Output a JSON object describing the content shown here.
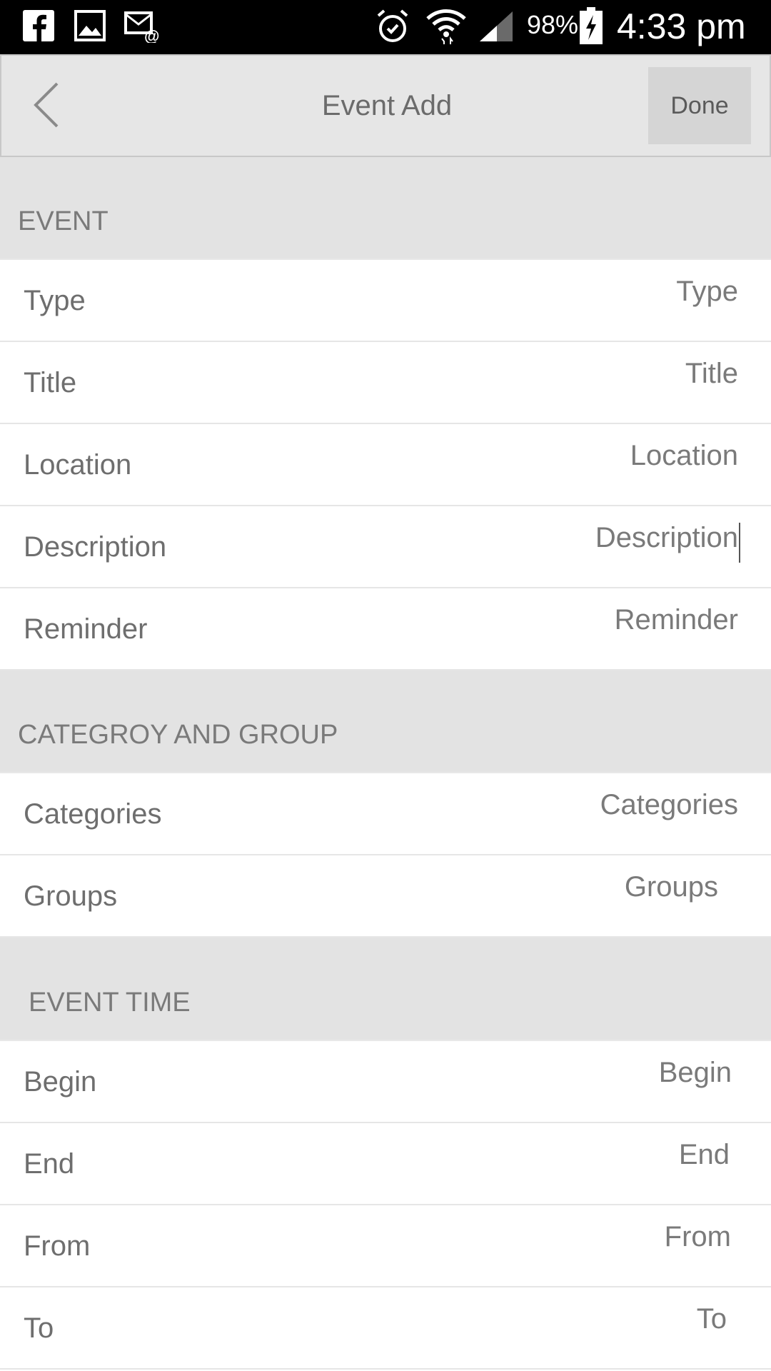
{
  "status_bar": {
    "battery": "98%",
    "time": "4:33 pm",
    "icons": [
      "facebook-icon",
      "image-icon",
      "email-icon",
      "alarm-icon",
      "wifi-icon",
      "signal-icon",
      "battery-charging-icon"
    ]
  },
  "nav": {
    "title": "Event Add",
    "done_label": "Done"
  },
  "sections": {
    "event": {
      "header": "EVENT",
      "rows": [
        {
          "label": "Type",
          "placeholder": "Type"
        },
        {
          "label": "Title",
          "placeholder": "Title"
        },
        {
          "label": "Location",
          "placeholder": "Location"
        },
        {
          "label": "Description",
          "placeholder": "Description"
        },
        {
          "label": "Reminder",
          "placeholder": "Reminder"
        }
      ]
    },
    "category_group": {
      "header": "CATEGROY AND GROUP",
      "rows": [
        {
          "label": "Categories",
          "placeholder": "Categories"
        },
        {
          "label": "Groups",
          "placeholder": "Groups"
        }
      ]
    },
    "event_time": {
      "header": "EVENT TIME",
      "rows": [
        {
          "label": "Begin",
          "placeholder": "Begin"
        },
        {
          "label": "End",
          "placeholder": "End"
        },
        {
          "label": "From",
          "placeholder": "From"
        },
        {
          "label": "To",
          "placeholder": "To"
        }
      ]
    }
  }
}
